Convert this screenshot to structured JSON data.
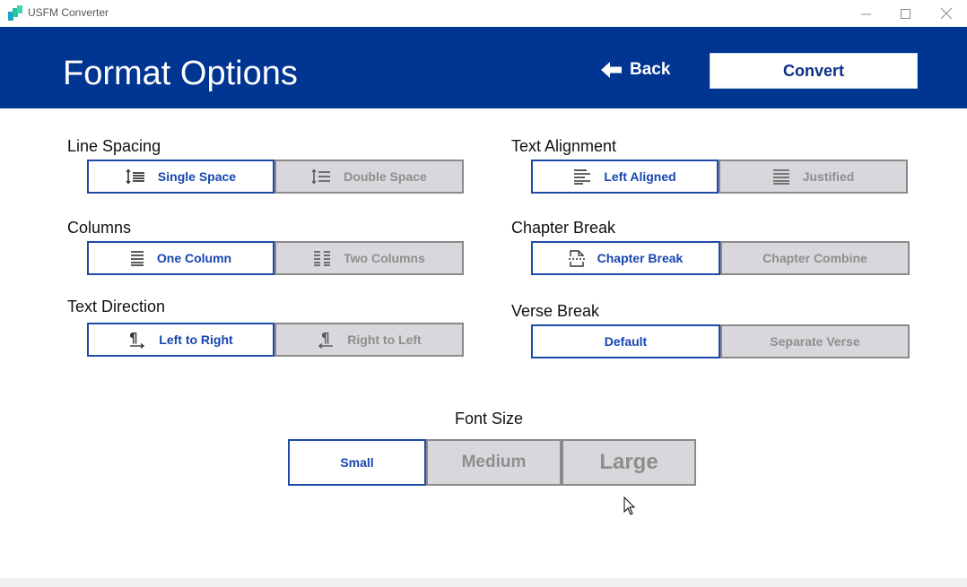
{
  "window": {
    "title": "USFM Converter"
  },
  "header": {
    "title": "Format Options",
    "back_label": "Back",
    "convert_label": "Convert"
  },
  "groups": {
    "line_spacing": {
      "label": "Line Spacing",
      "options": [
        "Single Space",
        "Double Space"
      ],
      "selected": "Single Space"
    },
    "text_alignment": {
      "label": "Text Alignment",
      "options": [
        "Left Aligned",
        "Justified"
      ],
      "selected": "Left Aligned"
    },
    "columns": {
      "label": "Columns",
      "options": [
        "One Column",
        "Two Columns"
      ],
      "selected": "One Column"
    },
    "chapter_break": {
      "label": "Chapter Break",
      "options": [
        "Chapter Break",
        "Chapter Combine"
      ],
      "selected": "Chapter Break"
    },
    "text_direction": {
      "label": "Text Direction",
      "options": [
        "Left to Right",
        "Right to Left"
      ],
      "selected": "Left to Right"
    },
    "verse_break": {
      "label": "Verse Break",
      "options": [
        "Default",
        "Separate Verse"
      ],
      "selected": "Default"
    },
    "font_size": {
      "label": "Font Size",
      "options": [
        "Small",
        "Medium",
        "Large"
      ],
      "selected": "Small"
    }
  },
  "colors": {
    "header_bg": "#003591",
    "selected_text": "#1746b0",
    "unselected_bg": "#d8d8dc"
  },
  "icons": {
    "single_space": "line-spacing-single-icon",
    "double_space": "line-spacing-double-icon",
    "left_aligned": "align-left-icon",
    "justified": "align-justify-icon",
    "one_column": "one-column-icon",
    "two_columns": "two-columns-icon",
    "chapter_break": "page-break-icon",
    "ltr": "text-direction-ltr-icon",
    "rtl": "text-direction-rtl-icon"
  }
}
